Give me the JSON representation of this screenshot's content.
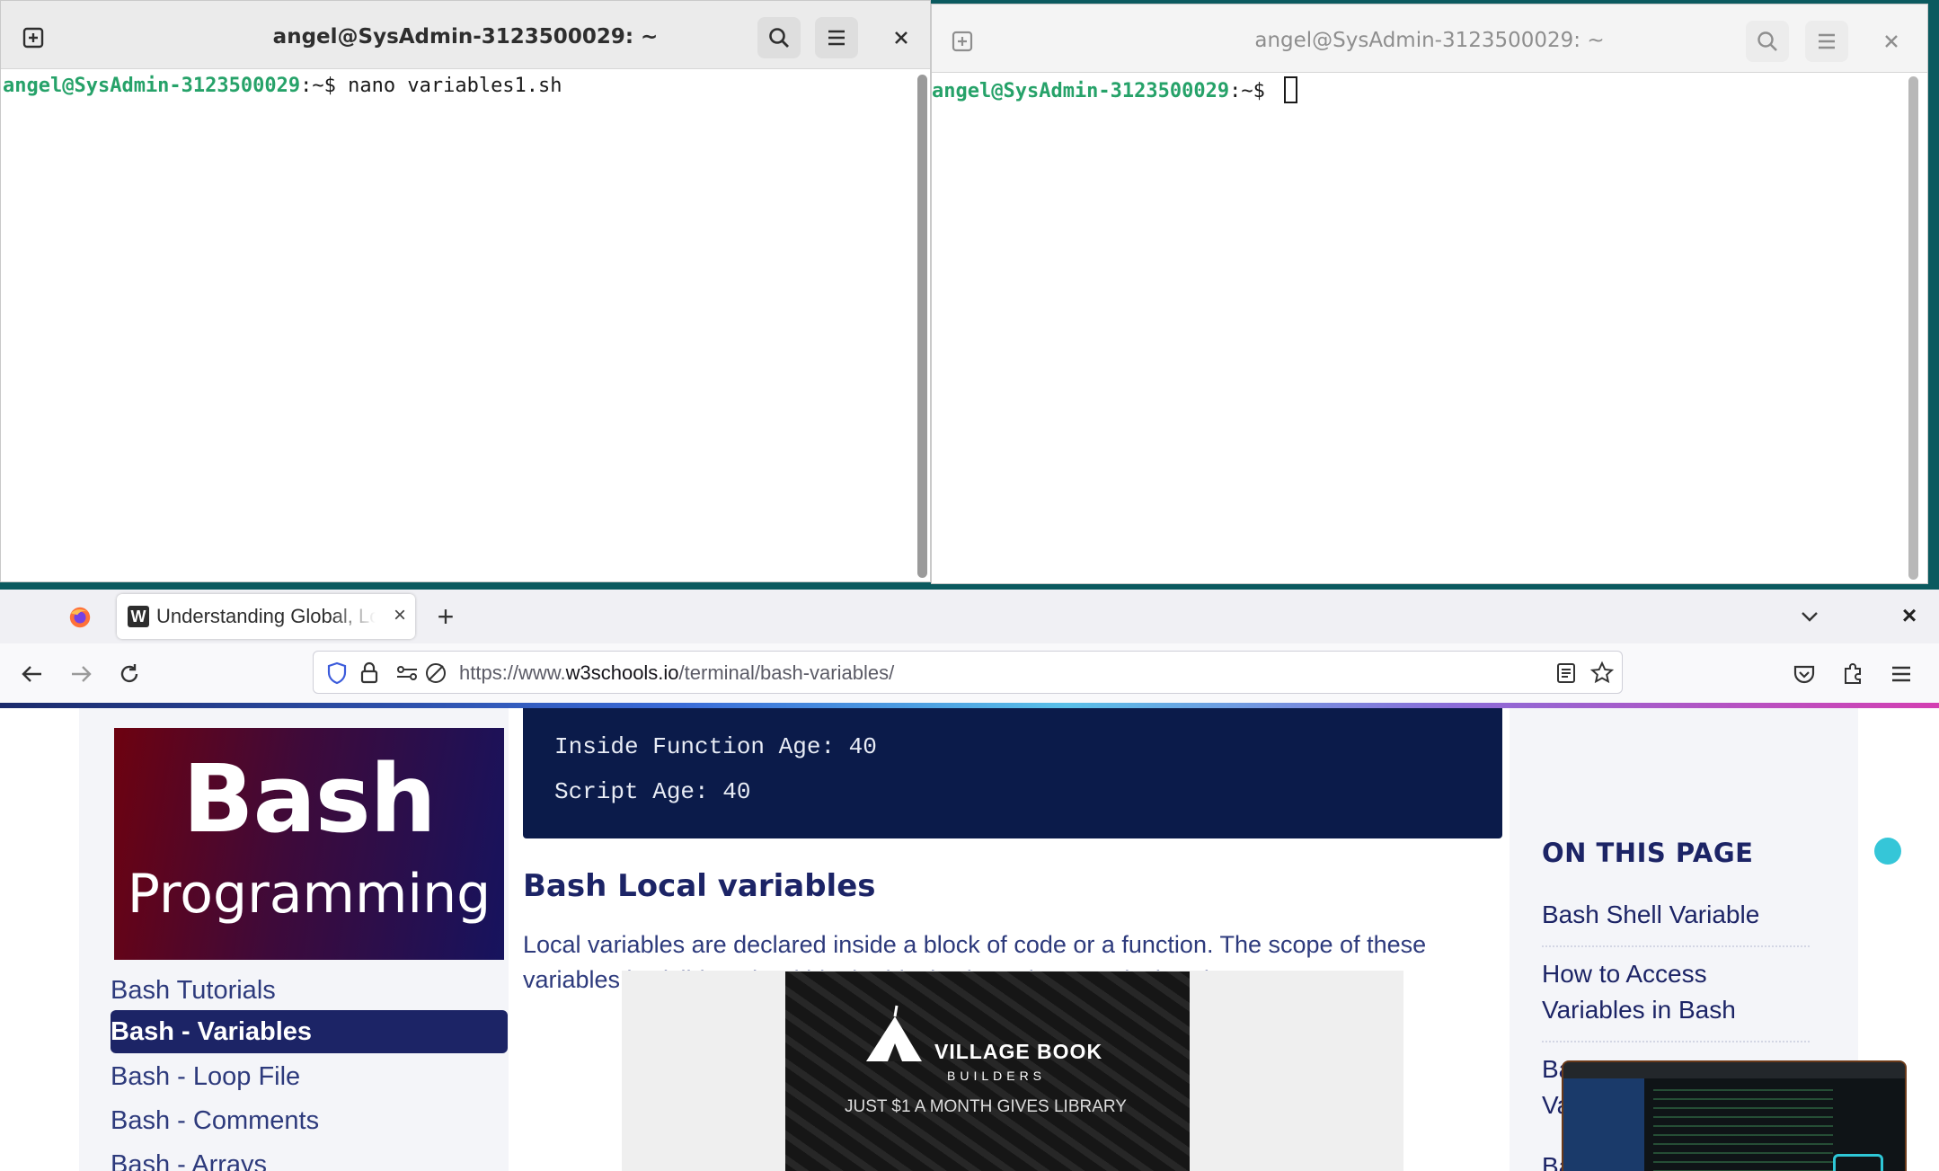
{
  "terminal_left": {
    "title": "angel@SysAdmin-3123500029: ~",
    "prompt_user": "angel@SysAdmin-3123500029",
    "prompt_sep": ":~$ ",
    "command": "nano variables1.sh"
  },
  "terminal_right": {
    "title": "angel@SysAdmin-3123500029: ~",
    "prompt_user": "angel@SysAdmin-3123500029",
    "prompt_sep": ":~$ "
  },
  "browser": {
    "tab_title": "Understanding Global, Local",
    "tab_close": "×",
    "new_tab": "+",
    "url_prefix": "https://www.",
    "url_domain": "w3schools.io",
    "url_path": "/terminal/bash-variables/",
    "close_window": "×"
  },
  "page": {
    "banner_line1": "Bash",
    "banner_line2": "Programming",
    "sidebar": [
      {
        "label": "Bash Tutorials",
        "active": false
      },
      {
        "label": "Bash - Variables",
        "active": true
      },
      {
        "label": "Bash - Loop File",
        "active": false
      },
      {
        "label": "Bash - Comments",
        "active": false
      },
      {
        "label": "Bash - Arrays",
        "active": false
      }
    ],
    "code_lines": [
      "Inside Function Age: 40",
      "Script Age: 40"
    ],
    "section_heading": "Bash Local variables",
    "section_paragraph": "Local variables are declared inside a block of code or a function. The scope of these variables is visible only within the block where they are declared.",
    "ad": {
      "line1": "VILLAGE BOOK",
      "line2": "BUILDERS",
      "line3": "JUST $1 A MONTH GIVES LIBRARY"
    },
    "on_this_page": {
      "heading": "ON THIS PAGE",
      "links": [
        "Bash Shell Variable",
        "How to Access Variables in Bash",
        "Bash Variables",
        "Bash"
      ]
    }
  },
  "colors": {
    "prompt_user": "#26a269",
    "nav_dark": "#1c2466",
    "code_bg": "#0b1b4a",
    "desktop_bg": "#0b5a5f"
  }
}
